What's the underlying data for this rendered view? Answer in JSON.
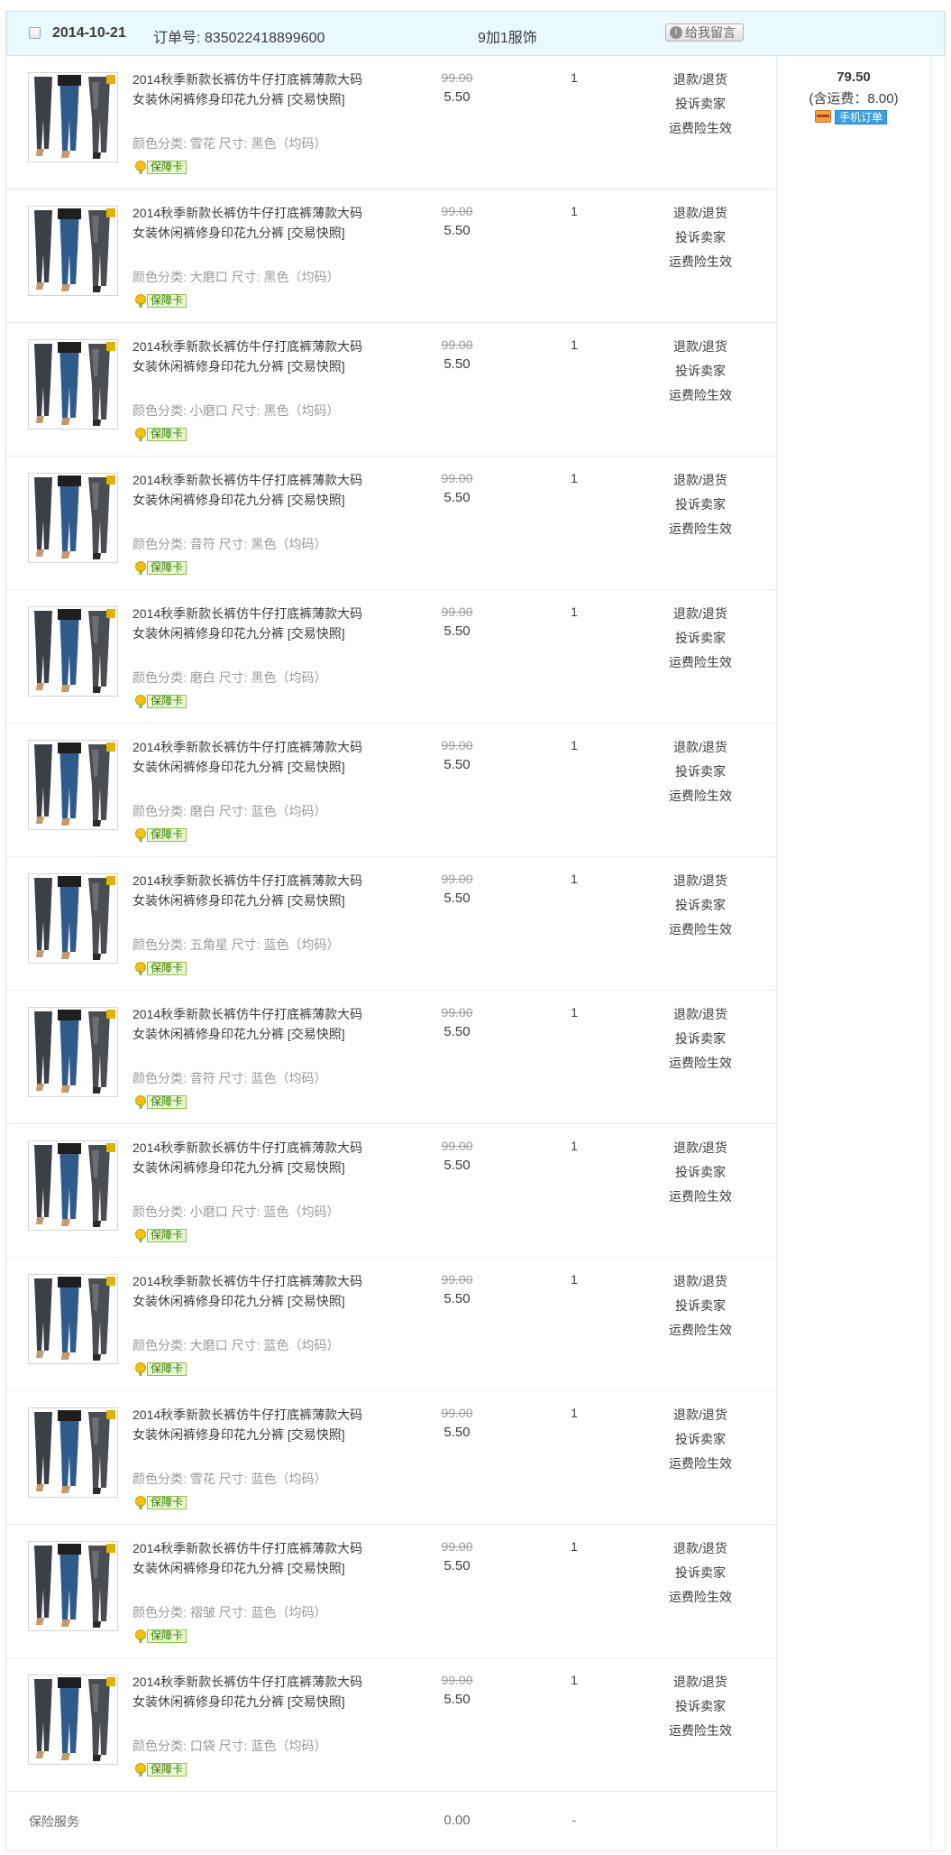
{
  "order": {
    "date": "2014-10-21",
    "order_number_label": "订单号:",
    "order_number": "835022418899600",
    "shop_name": "9加1服饰",
    "message_button": "给我留言",
    "total": "79.50",
    "shipping_note": "(含运费：8.00)",
    "mobile_tag": "手机订单"
  },
  "item_actions": [
    "退款/退货",
    "投诉卖家",
    "运费险生效"
  ],
  "guarantee_label": "保障卡",
  "items": [
    {
      "title": "2014秋季新款长裤仿牛仔打底裤薄款大码女装休闲裤修身印花九分裤 [交易快照]",
      "attrs": "颜色分类: 雪花  尺寸: 黑色（均码）",
      "original_price": "99.00",
      "price": "5.50",
      "quantity": "1"
    },
    {
      "title": "2014秋季新款长裤仿牛仔打底裤薄款大码女装休闲裤修身印花九分裤 [交易快照]",
      "attrs": "颜色分类: 大磨口  尺寸: 黑色（均码）",
      "original_price": "99.00",
      "price": "5.50",
      "quantity": "1"
    },
    {
      "title": "2014秋季新款长裤仿牛仔打底裤薄款大码女装休闲裤修身印花九分裤 [交易快照]",
      "attrs": "颜色分类: 小磨口  尺寸: 黑色（均码）",
      "original_price": "99.00",
      "price": "5.50",
      "quantity": "1"
    },
    {
      "title": "2014秋季新款长裤仿牛仔打底裤薄款大码女装休闲裤修身印花九分裤 [交易快照]",
      "attrs": "颜色分类: 音符  尺寸: 黑色（均码）",
      "original_price": "99.00",
      "price": "5.50",
      "quantity": "1"
    },
    {
      "title": "2014秋季新款长裤仿牛仔打底裤薄款大码女装休闲裤修身印花九分裤 [交易快照]",
      "attrs": "颜色分类: 磨白  尺寸: 黑色（均码）",
      "original_price": "99.00",
      "price": "5.50",
      "quantity": "1"
    },
    {
      "title": "2014秋季新款长裤仿牛仔打底裤薄款大码女装休闲裤修身印花九分裤 [交易快照]",
      "attrs": "颜色分类: 磨白  尺寸: 蓝色（均码）",
      "original_price": "99.00",
      "price": "5.50",
      "quantity": "1"
    },
    {
      "title": "2014秋季新款长裤仿牛仔打底裤薄款大码女装休闲裤修身印花九分裤 [交易快照]",
      "attrs": "颜色分类: 五角星  尺寸: 蓝色（均码）",
      "original_price": "99.00",
      "price": "5.50",
      "quantity": "1"
    },
    {
      "title": "2014秋季新款长裤仿牛仔打底裤薄款大码女装休闲裤修身印花九分裤 [交易快照]",
      "attrs": "颜色分类: 音符  尺寸: 蓝色（均码）",
      "original_price": "99.00",
      "price": "5.50",
      "quantity": "1"
    },
    {
      "title": "2014秋季新款长裤仿牛仔打底裤薄款大码女装休闲裤修身印花九分裤 [交易快照]",
      "attrs": "颜色分类: 小磨口  尺寸: 蓝色（均码）",
      "original_price": "99.00",
      "price": "5.50",
      "quantity": "1"
    },
    {
      "title": "2014秋季新款长裤仿牛仔打底裤薄款大码女装休闲裤修身印花九分裤 [交易快照]",
      "attrs": "颜色分类: 大磨口  尺寸: 蓝色（均码）",
      "original_price": "99.00",
      "price": "5.50",
      "quantity": "1"
    },
    {
      "title": "2014秋季新款长裤仿牛仔打底裤薄款大码女装休闲裤修身印花九分裤 [交易快照]",
      "attrs": "颜色分类: 雪花  尺寸: 蓝色（均码）",
      "original_price": "99.00",
      "price": "5.50",
      "quantity": "1"
    },
    {
      "title": "2014秋季新款长裤仿牛仔打底裤薄款大码女装休闲裤修身印花九分裤 [交易快照]",
      "attrs": "颜色分类: 褶皱  尺寸: 蓝色（均码）",
      "original_price": "99.00",
      "price": "5.50",
      "quantity": "1"
    },
    {
      "title": "2014秋季新款长裤仿牛仔打底裤薄款大码女装休闲裤修身印花九分裤 [交易快照]",
      "attrs": "颜色分类: 口袋  尺寸: 蓝色（均码）",
      "original_price": "99.00",
      "price": "5.50",
      "quantity": "1"
    }
  ],
  "insurance": {
    "label": "保险服务",
    "price": "0.00",
    "quantity": "-"
  },
  "colors": {
    "header_bg": "#eaf8ff",
    "border": "#e6ecf2",
    "muted_text": "#9a9a9a",
    "mobile_tag": "#3f9fe0",
    "guarantee_green": "#8bc34a"
  }
}
